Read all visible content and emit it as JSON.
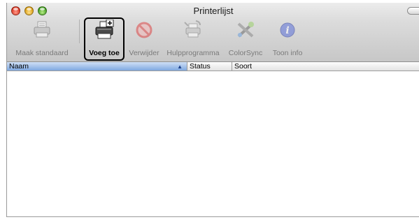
{
  "window": {
    "title": "Printerlijst"
  },
  "toolbar": {
    "items": [
      {
        "id": "make-default",
        "label": "Maak standaard",
        "icon": "printer-default-icon",
        "enabled": false
      },
      {
        "id": "add",
        "label": "Voeg toe",
        "icon": "add-printer-icon",
        "enabled": true
      },
      {
        "id": "delete",
        "label": "Verwijder",
        "icon": "delete-icon",
        "enabled": false
      },
      {
        "id": "utility",
        "label": "Hulpprogramma",
        "icon": "utility-icon",
        "enabled": false
      },
      {
        "id": "colorsync",
        "label": "ColorSync",
        "icon": "colorsync-icon",
        "enabled": false
      },
      {
        "id": "info",
        "label": "Toon info",
        "icon": "info-icon",
        "enabled": false
      }
    ]
  },
  "table": {
    "columns": [
      {
        "label": "Naam",
        "sorted": true,
        "sort_direction": "ascending"
      },
      {
        "label": "Status",
        "sorted": false
      },
      {
        "label": "Soort",
        "sorted": false
      }
    ],
    "rows": []
  },
  "colors": {
    "sort_header": "#7fa8e0",
    "highlight_border": "#000000"
  }
}
